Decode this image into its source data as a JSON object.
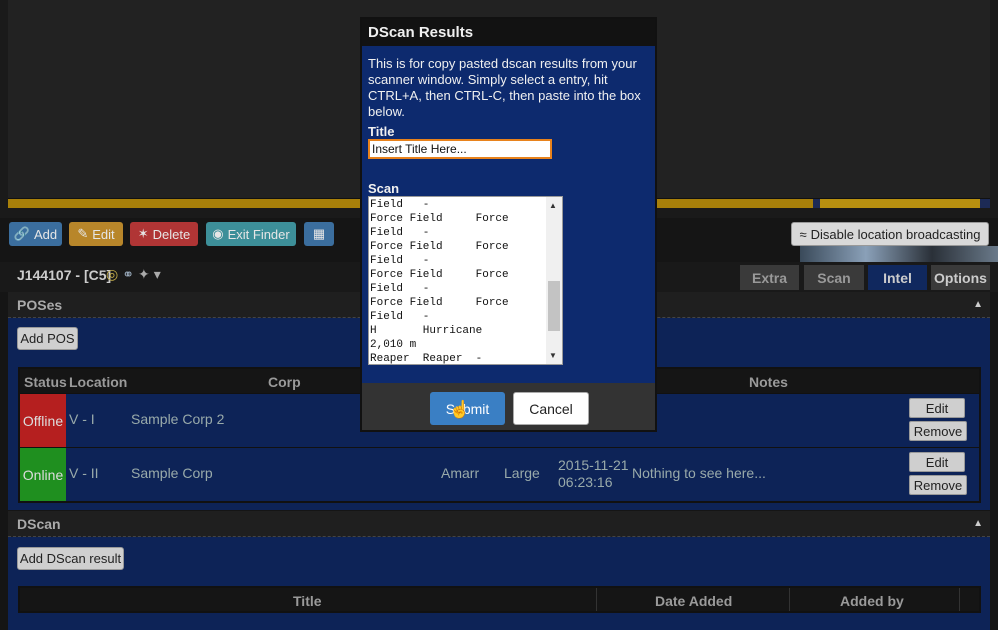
{
  "toolbar": {
    "add_label": "Add",
    "edit_label": "Edit",
    "delete_label": "Delete",
    "exit_finder_label": "Exit Finder",
    "broadcast_label": "Disable location broadcasting",
    "icons": {
      "add": "link-icon",
      "edit": "pencil-icon",
      "delete": "unlink-icon",
      "exit": "binoculars-icon",
      "table": "table-icon",
      "broadcast": "wifi-icon"
    },
    "colors": {
      "add": "#3b6e9e",
      "edit": "#b8862a",
      "delete": "#b03535",
      "exit": "#3d8f99"
    }
  },
  "system": {
    "name": "J144107 - [C5]",
    "icons": [
      "effect-icon",
      "statics-icon",
      "ships-icon",
      "dropdown-icon"
    ]
  },
  "tabs": [
    "Extra",
    "Scan",
    "Intel",
    "Options"
  ],
  "tab_active": "Intel",
  "poses": {
    "header": "POSes",
    "add_button": "Add POS",
    "columns": [
      "Status",
      "Location",
      "Corp",
      "Notes"
    ],
    "rows": [
      {
        "status": "Offline",
        "location": "V - I",
        "corp": "Sample Corp 2",
        "edit": "Edit",
        "remove": "Remove"
      },
      {
        "status": "Online",
        "location": "V - II",
        "corp": "Sample Corp",
        "race": "Amarr",
        "size": "Large",
        "date": "2015-11-21",
        "time": "06:23:16",
        "notes": "Nothing to see here...",
        "edit": "Edit",
        "remove": "Remove"
      }
    ]
  },
  "dscan": {
    "header": "DScan",
    "add_button": "Add DScan result",
    "columns": [
      "Title",
      "Date Added",
      "Added by"
    ]
  },
  "modal": {
    "title": "DScan Results",
    "intro": "This is for copy pasted dscan results from your scanner window. Simply select a entry, hit CTRL+A, then CTRL-C, then paste into the box below.",
    "title_label": "Title",
    "title_value": "Insert Title Here...",
    "scan_label": "Scan",
    "scan_text": "Field   -\nForce Field     Force\nField   -\nForce Field     Force\nField   -\nForce Field     Force\nField   -\nForce Field     Force\nField   -\nH       Hurricane\n2,010 m\nReaper  Reaper  -",
    "submit": "Submit",
    "cancel": "Cancel"
  }
}
